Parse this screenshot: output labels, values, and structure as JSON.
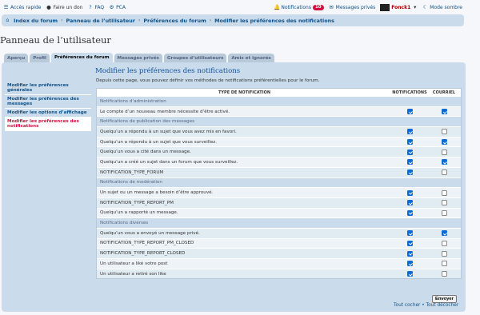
{
  "topbar": {
    "quick_access": "Accès rapide",
    "donate": "Faire un don",
    "faq": "FAQ",
    "acp": "PCA",
    "notifications_label": "Notifications",
    "notifications_count": "10",
    "messages_label": "Messages privés",
    "username": "Fonck1",
    "dark_mode": "Mode sombre"
  },
  "breadcrumbs": [
    "Index du forum",
    "Panneau de l’utilisateur",
    "Préférences du forum",
    "Modifier les préférences des notifications"
  ],
  "page_title": "Panneau de l’utilisateur",
  "tabs": [
    "Aperçu",
    "Profil",
    "Préférences du forum",
    "Messages privés",
    "Groupes d’utilisateurs",
    "Amis et ignorés"
  ],
  "sidebar": [
    "Modifier les préférences générales",
    "Modifier les préférences des messages",
    "Modifier les options d’affichage",
    "Modifier les préférences des notifications"
  ],
  "main": {
    "title": "Modifier les préférences des notifications",
    "description": "Depuis cette page, vous pouvez définir vos méthodes de notifications préférentielles pour le forum.",
    "col_type": "TYPE DE NOTIFICATION",
    "col_notif": "NOTIFICATIONS",
    "col_mail": "COURRIEL"
  },
  "groups": [
    {
      "title": "Notifications d’administration",
      "rows": [
        {
          "label": "Le compte d’un nouveau membre nécessite d’être activé.",
          "notif": true,
          "mail": true
        }
      ]
    },
    {
      "title": "Notifications de publication des messages",
      "rows": [
        {
          "label": "Quelqu’un a répondu à un sujet que vous avez mis en favori.",
          "notif": true,
          "mail": false
        },
        {
          "label": "Quelqu’un a répondu à un sujet que vous surveillez.",
          "notif": true,
          "mail": true
        },
        {
          "label": "Quelqu’un vous a cité dans un message.",
          "notif": true,
          "mail": false
        },
        {
          "label": "Quelqu’un a créé un sujet dans un forum que vous surveillez.",
          "notif": true,
          "mail": true
        },
        {
          "label": "NOTIFICATION_TYPE_FORUM",
          "notif": true,
          "mail": false
        }
      ]
    },
    {
      "title": "Notifications de modération",
      "rows": [
        {
          "label": "Un sujet ou un message a besoin d’être approuvé.",
          "notif": true,
          "mail": false
        },
        {
          "label": "NOTIFICATION_TYPE_REPORT_PM",
          "notif": true,
          "mail": false
        },
        {
          "label": "Quelqu’un a rapporté un message.",
          "notif": true,
          "mail": false
        }
      ]
    },
    {
      "title": "Notifications diverses",
      "rows": [
        {
          "label": "Quelqu’un vous a envoyé un message privé.",
          "notif": true,
          "mail": true
        },
        {
          "label": "NOTIFICATION_TYPE_REPORT_PM_CLOSED",
          "notif": true,
          "mail": false
        },
        {
          "label": "NOTIFICATION_TYPE_REPORT_CLOSED",
          "notif": true,
          "mail": false
        },
        {
          "label": "Un utilisateur a liké votre post",
          "notif": true,
          "mail": false
        },
        {
          "label": "Un utilisateur a retiré son like",
          "notif": true,
          "mail": false
        }
      ]
    }
  ],
  "submit_label": "Envoyer",
  "mark_all": "Tout cocher",
  "unmark_all": "Tout décocher",
  "bottom_sep": " • "
}
